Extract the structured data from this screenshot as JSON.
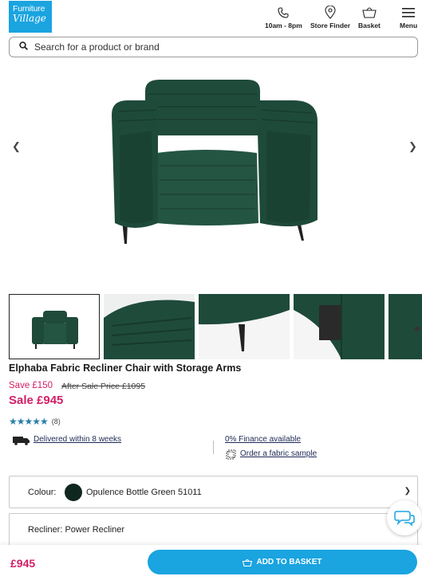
{
  "header": {
    "logo_line1": "Furniture",
    "logo_line2": "Village",
    "nav": [
      {
        "label": "10am - 8pm",
        "icon": "phone-icon"
      },
      {
        "label": "Store Finder",
        "icon": "map-pin-icon"
      },
      {
        "label": "Basket",
        "icon": "basket-icon"
      },
      {
        "label": "Menu",
        "icon": "hamburger-icon"
      }
    ]
  },
  "search": {
    "placeholder": "Search for a product or brand"
  },
  "product": {
    "title": "Elphaba Fabric Recliner Chair with Storage Arms",
    "save": "Save £150",
    "after_sale": "After Sale Price £1095",
    "sale_price": "Sale £945",
    "rating_value": 4.5,
    "rating_count": "(8)",
    "stars": "★★★★★",
    "delivery": "Delivered within 8 weeks",
    "finance": "0% Finance available",
    "sample": "Order a fabric sample"
  },
  "options": {
    "colour_label": "Colour:",
    "colour_value": "Opulence Bottle Green 51011",
    "colour_hex": "#10271f",
    "recliner": "Recliner: Power Recliner"
  },
  "bottom": {
    "price": "£945",
    "add_to_basket": "ADD TO BASKET"
  },
  "colors": {
    "brand": "#1aa4e0",
    "sale": "#d21e66",
    "fabric": "#1e4a3a"
  }
}
